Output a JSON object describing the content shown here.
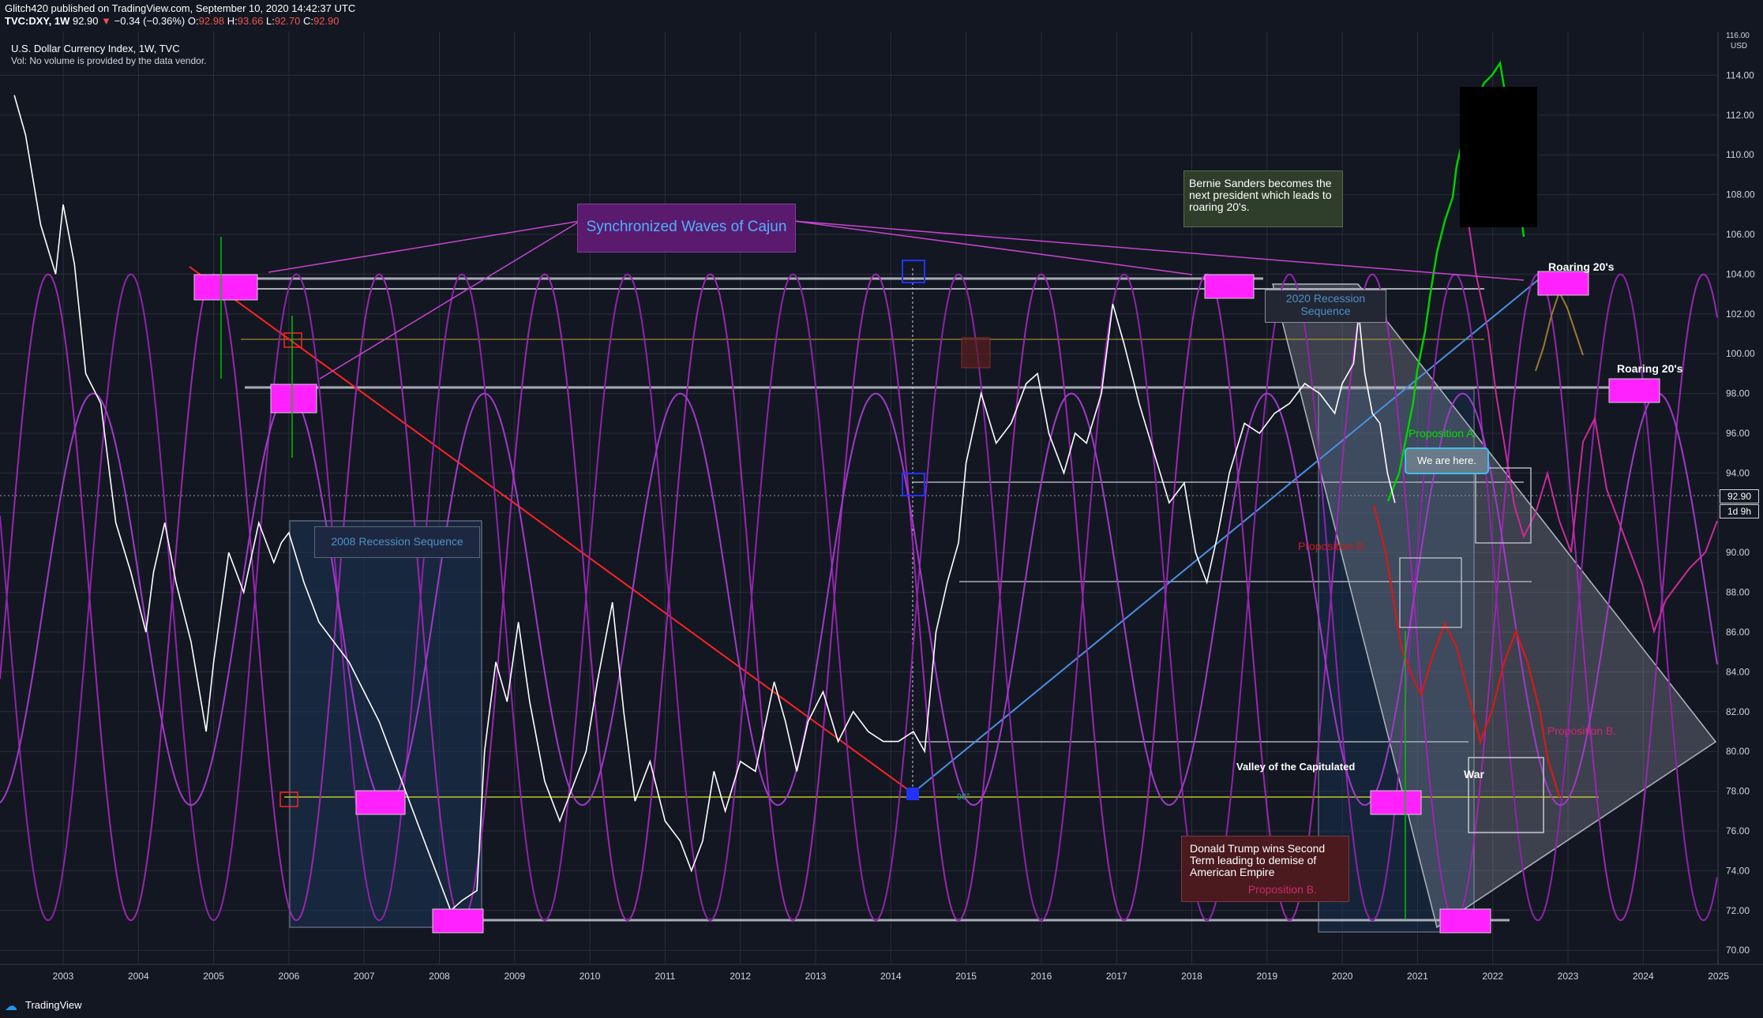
{
  "header": {
    "published": "Glitch420 published on TradingView.com, September 10, 2020 14:42:37 UTC",
    "symbol": "TVC:DXY, 1W",
    "last": "92.90",
    "change": "−0.34 (−0.36%)",
    "o_label": "O:",
    "o": "92.98",
    "h_label": "H:",
    "h": "93.66",
    "l_label": "L:",
    "l": "92.70",
    "c_label": "C:",
    "c": "92.90"
  },
  "legend": {
    "title": "U.S. Dollar Currency Index, 1W, TVC",
    "vol_note": "Vol: No volume is provided by the data vendor."
  },
  "price_axis": {
    "currency": "USD",
    "top_partial": "116.00",
    "last_price_tag": "92.90",
    "countdown_tag": "1d 9h",
    "ticks": [
      "114.00",
      "112.00",
      "110.00",
      "108.00",
      "106.00",
      "104.00",
      "102.00",
      "100.00",
      "98.00",
      "96.00",
      "94.00",
      "92.00",
      "90.00",
      "88.00",
      "86.00",
      "84.00",
      "82.00",
      "80.00",
      "78.00",
      "76.00",
      "74.00",
      "72.00",
      "70.00"
    ]
  },
  "time_axis": {
    "ticks": [
      "2003",
      "2004",
      "2005",
      "2006",
      "2007",
      "2008",
      "2009",
      "2010",
      "2011",
      "2012",
      "2013",
      "2014",
      "2015",
      "2016",
      "2017",
      "2018",
      "2019",
      "2020",
      "2021",
      "2022",
      "2023",
      "2024",
      "2025"
    ]
  },
  "annotations": {
    "sync_waves": "Synchronized Waves of Cajun",
    "recession_2008": "2008 Recession Sequence",
    "recession_2020": "2020 Recession Sequence",
    "bernie": "Bernie Sanders becomes the next president which leads to roaring 20's.",
    "roaring_1": "Roaring 20's",
    "roaring_2": "Roaring 20's",
    "prop_a": "Proposition A.",
    "we_are_here": "We are here.",
    "prop_b_1": "Proposition B.",
    "prop_b_2": "Proposition B.",
    "prop_b_3": "Proposition B.",
    "valley": "Valley of the Capitulated",
    "war": "War",
    "trump": "Donald Trump wins Second Term leading to demise of American Empire",
    "angle": "90°"
  },
  "footer": {
    "brand": "TradingView"
  },
  "colors": {
    "background": "#131722",
    "price_line": "#ffffff",
    "wave": "#9c27b0",
    "magenta": "#ff00ff",
    "red_line": "#ff2020",
    "blue_line": "#4a90e2",
    "recession_fill": "#1e3a5f",
    "green_projection": "#00e000",
    "red_projection": "#c81e1e",
    "pink_projection": "#cc2a9a",
    "orange_projection": "#9a7a30",
    "down_arrow": "#ef5350"
  },
  "chart_data": {
    "type": "line",
    "title": "U.S. Dollar Currency Index, 1W, TVC",
    "xlabel": "",
    "ylabel": "",
    "xlim": [
      2002.3,
      2025.1
    ],
    "ylim": [
      69.2,
      116.3
    ],
    "grid": true,
    "series": [
      {
        "name": "",
        "x": [
          2002.35,
          2002.5,
          2002.7,
          2002.9,
          2003.0,
          2003.15,
          2003.3,
          2003.5,
          2003.7,
          2003.9,
          2004.0,
          2004.1,
          2004.2,
          2004.35,
          2004.5,
          2004.7,
          2004.9,
          2005.0,
          2005.2,
          2005.4,
          2005.6,
          2005.8,
          2005.9,
          2006.0,
          2006.2,
          2006.4,
          2006.6,
          2006.8,
          2007.0,
          2007.2,
          2007.4,
          2007.6,
          2007.8,
          2008.0,
          2008.15,
          2008.3,
          2008.5,
          2008.6,
          2008.75,
          2008.9,
          2009.05,
          2009.2,
          2009.4,
          2009.6,
          2009.8,
          2009.95,
          2010.1,
          2010.3,
          2010.45,
          2010.6,
          2010.8,
          2011.0,
          2011.2,
          2011.35,
          2011.5,
          2011.65,
          2011.8,
          2012.0,
          2012.2,
          2012.45,
          2012.6,
          2012.75,
          2012.9,
          2013.1,
          2013.3,
          2013.5,
          2013.7,
          2013.9,
          2014.1,
          2014.3,
          2014.45,
          2014.6,
          2014.75,
          2014.9,
          2015.0,
          2015.2,
          2015.4,
          2015.6,
          2015.8,
          2015.95,
          2016.1,
          2016.3,
          2016.45,
          2016.6,
          2016.8,
          2016.95,
          2017.1,
          2017.3,
          2017.5,
          2017.7,
          2017.9,
          2018.05,
          2018.2,
          2018.35,
          2018.5,
          2018.7,
          2018.9,
          2019.1,
          2019.3,
          2019.5,
          2019.7,
          2019.9,
          2020.0,
          2020.15,
          2020.22,
          2020.3,
          2020.4,
          2020.5,
          2020.6,
          2020.7
        ],
        "y": [
          113.0,
          111.0,
          106.5,
          104.0,
          107.5,
          104.5,
          99.0,
          97.5,
          91.5,
          89.0,
          87.5,
          86.0,
          89.0,
          91.5,
          88.5,
          85.5,
          81.0,
          84.5,
          90.0,
          88.0,
          91.5,
          89.5,
          90.5,
          91.0,
          88.5,
          86.5,
          85.5,
          84.5,
          83.0,
          81.5,
          79.5,
          77.5,
          75.5,
          73.5,
          72.0,
          72.5,
          73.0,
          80.0,
          84.5,
          82.5,
          86.5,
          82.5,
          78.5,
          76.5,
          78.5,
          80.0,
          83.5,
          87.5,
          82.0,
          77.5,
          79.5,
          76.5,
          75.5,
          74.0,
          75.5,
          79.0,
          77.0,
          79.5,
          79.0,
          83.5,
          81.5,
          79.0,
          81.5,
          83.0,
          80.5,
          82.0,
          81.0,
          80.5,
          80.5,
          81.0,
          80.0,
          86.0,
          88.5,
          90.5,
          94.5,
          98.0,
          95.5,
          96.5,
          98.5,
          99.0,
          96.0,
          94.0,
          96.0,
          95.5,
          98.0,
          102.5,
          100.5,
          97.5,
          95.0,
          92.5,
          93.5,
          90.0,
          88.5,
          91.0,
          94.0,
          96.5,
          96.0,
          97.0,
          97.5,
          98.5,
          98.0,
          97.0,
          98.5,
          99.5,
          102.0,
          99.0,
          97.0,
          96.5,
          94.0,
          92.5
        ]
      }
    ]
  }
}
